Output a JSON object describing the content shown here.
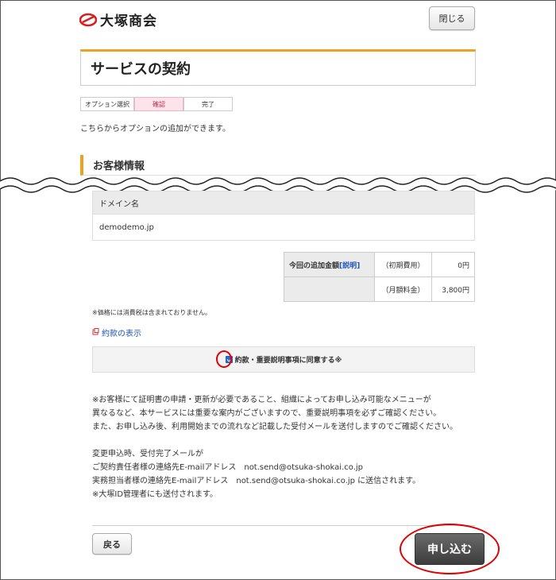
{
  "header": {
    "brand": "大塚商会",
    "close_label": "閉じる"
  },
  "page_title": "サービスの契約",
  "steps": [
    {
      "label": "オプション選択",
      "active": false
    },
    {
      "label": "確認",
      "active": true
    },
    {
      "label": "完了",
      "active": false
    }
  ],
  "intro": "こちらからオプションの追加ができます。",
  "section_title": "お客様情報",
  "domain": {
    "header": "ドメイン名",
    "value": "demodemo.jp"
  },
  "price": {
    "label": "今回の追加金額",
    "explain_link": "[説明]",
    "rows": [
      {
        "type": "（初期費用）",
        "amount": "0円"
      },
      {
        "type": "（月額料金）",
        "amount": "3,800円"
      }
    ]
  },
  "tax_note": "※価格には消費税は含まれておりません。",
  "terms_link": "約款の表示",
  "agree_label": "約款・重要説明事項に同意する※",
  "notes": [
    "※お客様にて証明書の申請・更新が必要であること、組織によってお申し込み可能なメニューが",
    "異なるなど、本サービスには重要な案内がございますので、重要説明事項を必ずご確認ください。",
    "また、お申し込み後、利用開始までの流れなど記載した受付メールを送付しますのでご確認ください。"
  ],
  "mail_notes": [
    "変更申込時、受付完了メールが",
    "ご契約責任者様の連絡先E-mailアドレス　not.send@otsuka-shokai.co.jp",
    "実務担当者様の連絡先E-mailアドレス　not.send@otsuka-shokai.co.jp に送信されます。",
    "※大塚ID管理者にも送付されます。"
  ],
  "back_label": "戻る",
  "submit_label": "申し込む",
  "colors": {
    "accent": "#f0a020",
    "highlight": "#e00000",
    "link": "#2255bb"
  }
}
